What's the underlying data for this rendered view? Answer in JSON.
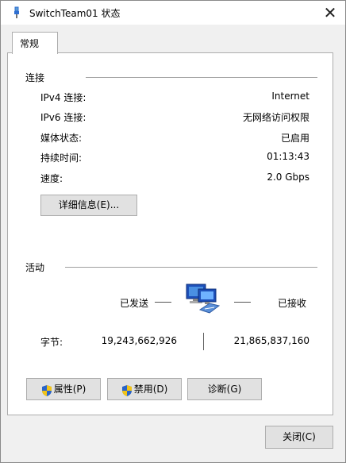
{
  "window": {
    "title": "SwitchTeam01 状态",
    "close_glyph": "✕"
  },
  "tabs": [
    {
      "label": "常规"
    }
  ],
  "connection": {
    "section_label": "连接",
    "rows": [
      {
        "label": "IPv4 连接:",
        "value": "Internet"
      },
      {
        "label": "IPv6 连接:",
        "value": "无网络访问权限"
      },
      {
        "label": "媒体状态:",
        "value": "已启用"
      },
      {
        "label": "持续时间:",
        "value": "01:13:43"
      },
      {
        "label": "速度:",
        "value": "2.0 Gbps"
      }
    ],
    "details_button": "详细信息(E)..."
  },
  "activity": {
    "section_label": "活动",
    "sent_label": "已发送",
    "received_label": "已接收",
    "bytes_label": "字节:",
    "bytes_sent": "19,243,662,926",
    "bytes_received": "21,865,837,160"
  },
  "actions": {
    "properties": "属性(P)",
    "disable": "禁用(D)",
    "diagnose": "诊断(G)"
  },
  "footer": {
    "close_button": "关闭(C)"
  },
  "colors": {
    "accent_blue": "#2f6fd1",
    "shield_blue": "#2a64c8",
    "shield_yellow": "#f2c417"
  },
  "icons": {
    "title": "network-adapter-icon",
    "activity": "network-computers-icon",
    "shield": "uac-shield-icon"
  }
}
